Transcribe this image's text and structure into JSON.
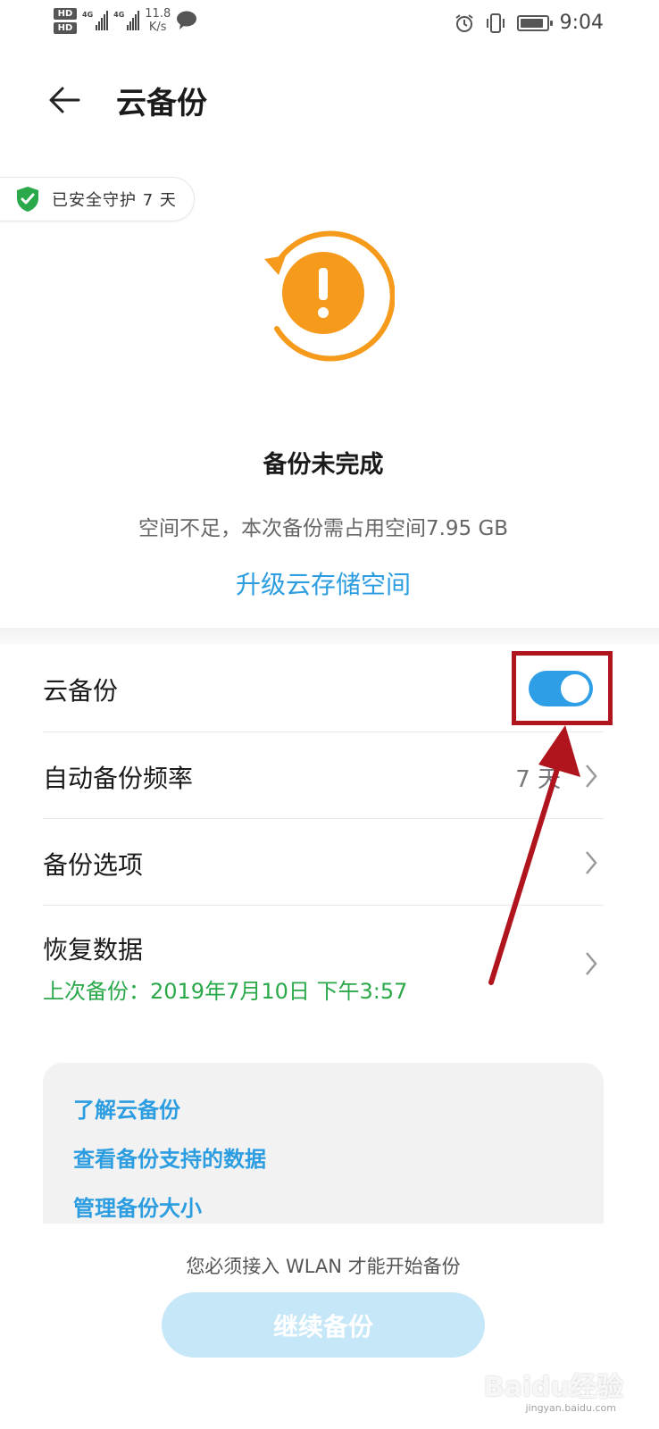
{
  "status_bar": {
    "hd1": "HD",
    "hd2": "HD",
    "net1": "4G",
    "net2": "4G",
    "speed_value": "11.8",
    "speed_unit": "K/s",
    "time": "9:04",
    "battery_level": 0.9,
    "icons": [
      "wechat-icon",
      "alarm-icon",
      "vibrate-icon",
      "battery-icon"
    ]
  },
  "header": {
    "title": "云备份",
    "back_icon": "arrow-left-icon"
  },
  "protection_badge": {
    "text": "已安全守护 7 天",
    "icon": "shield-check-icon"
  },
  "backup_status": {
    "icon": "warning-refresh-icon",
    "title": "备份未完成",
    "description": "空间不足，本次备份需占用空间7.95 GB",
    "upgrade_link": "升级云存储空间"
  },
  "settings": {
    "cloud_backup": {
      "label": "云备份",
      "enabled": true
    },
    "auto_frequency": {
      "label": "自动备份频率",
      "value": "7 天"
    },
    "backup_options": {
      "label": "备份选项"
    },
    "restore": {
      "label": "恢复数据",
      "last_backup": "上次备份：2019年7月10日 下午3:57"
    }
  },
  "info_card": {
    "links": [
      "了解云备份",
      "查看备份支持的数据",
      "管理备份大小"
    ]
  },
  "footer": {
    "note": "您必须接入 WLAN 才能开始备份",
    "continue_button": "继续备份"
  },
  "colors": {
    "accent": "#2e9fe6",
    "link": "#2c9de0",
    "warning": "#f59a1b",
    "success": "#2aa84a",
    "annotation": "#b0141c"
  },
  "watermark": {
    "text": "Baidu经验",
    "sub": "jingyan.baidu.com"
  }
}
